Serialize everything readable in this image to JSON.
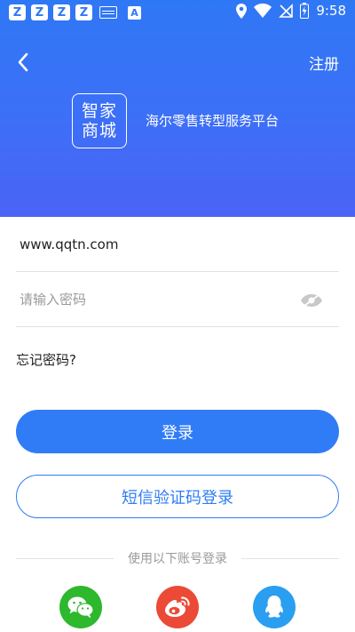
{
  "status_bar": {
    "time": "9:58",
    "notification_icons": [
      "z-icon",
      "z-icon",
      "z-icon",
      "z-icon",
      "keyboard-icon",
      "a-icon"
    ],
    "right_icons": [
      "location-icon",
      "wifi-icon",
      "no-sim-icon",
      "battery-icon"
    ]
  },
  "header": {
    "back_icon": "chevron-left-icon",
    "register_label": "注册",
    "logo_line1": "智家",
    "logo_line2": "商城",
    "slogan": "海尔零售转型服务平台"
  },
  "form": {
    "username_value": "www.qqtn.com",
    "password_placeholder": "请输入密码",
    "password_toggle_icon": "eye-hidden-icon",
    "forgot_label": "忘记密码?",
    "login_label": "登录",
    "sms_login_label": "短信验证码登录"
  },
  "social": {
    "divider_text": "使用以下账号登录",
    "providers": [
      "wechat-icon",
      "weibo-icon",
      "qq-icon"
    ]
  },
  "colors": {
    "accent": "#2f7cf6",
    "header_top": "#2f78f5",
    "header_bottom": "#4a63f6",
    "wechat": "#2db82d",
    "weibo": "#eb4a36",
    "qq": "#2a9ef0"
  }
}
